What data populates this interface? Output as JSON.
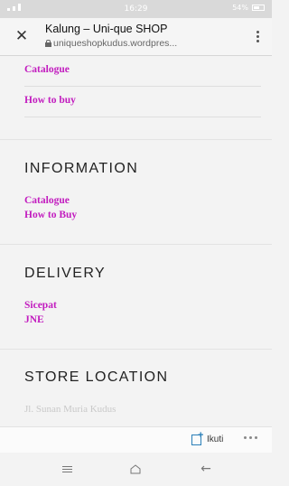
{
  "status_bar": {
    "time": "16:29",
    "battery": "54%"
  },
  "browser": {
    "close_icon": "close-icon",
    "page_title": "Kalung – Uni-que SHOP",
    "url": "uniqueshopkudus.wordpres...",
    "menu_icon": "more-vertical-icon"
  },
  "links_top": [
    "Catalogue",
    "How to buy"
  ],
  "sections": {
    "information": {
      "heading": "INFORMATION",
      "links": [
        "Catalogue",
        "How to Buy"
      ]
    },
    "delivery": {
      "heading": "DELIVERY",
      "links": [
        "Sicepat",
        "JNE"
      ]
    },
    "store_location": {
      "heading": "STORE LOCATION",
      "faded_text": "Jl. Sunan Muria Kudus"
    }
  },
  "bottom_bar": {
    "follow_label": "Ikuti",
    "follow_icon": "follow-icon",
    "more_icon": "more-horizontal-icon"
  },
  "nav": {
    "menu_icon": "menu-icon",
    "home_icon": "home-icon",
    "back_icon": "back-icon"
  },
  "colors": {
    "link": "#c21cbf",
    "heading": "#222222",
    "accent": "#2a7fb8"
  }
}
